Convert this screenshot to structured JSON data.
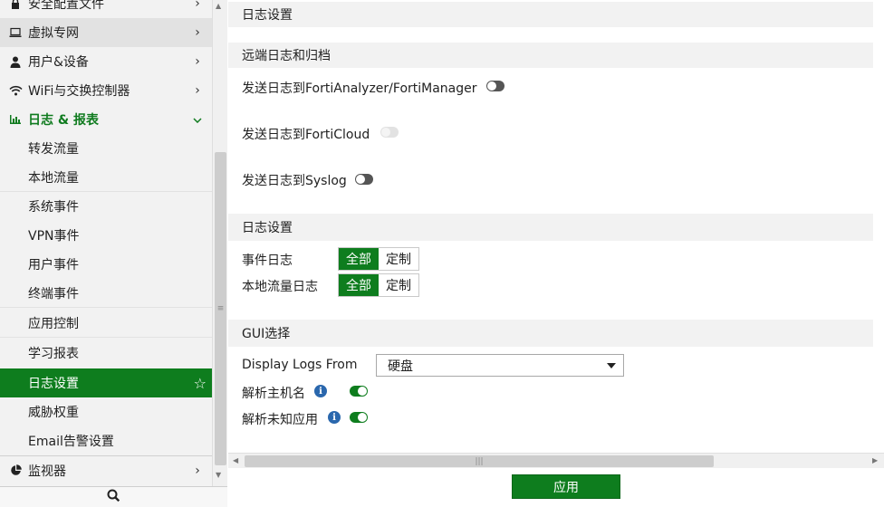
{
  "sidebar": {
    "items": [
      {
        "label": "安全配置文件",
        "icon": "lock-icon"
      },
      {
        "label": "虚拟专网",
        "icon": "laptop-icon"
      },
      {
        "label": "用户&设备",
        "icon": "user-icon"
      },
      {
        "label": "WiFi与交换控制器",
        "icon": "wifi-icon"
      },
      {
        "label": "日志 & 报表",
        "icon": "bar-chart-icon"
      }
    ],
    "subitems": [
      {
        "label": "转发流量"
      },
      {
        "label": "本地流量"
      },
      {
        "label": "系统事件"
      },
      {
        "label": "VPN事件"
      },
      {
        "label": "用户事件"
      },
      {
        "label": "终端事件"
      },
      {
        "label": "应用控制"
      },
      {
        "label": "学习报表"
      },
      {
        "label": "日志设置"
      },
      {
        "label": "威胁权重"
      },
      {
        "label": "Email告警设置"
      }
    ],
    "monitor": {
      "label": "监视器",
      "icon": "pie-chart-icon"
    },
    "search_icon": "search-icon",
    "accent": "#0e7d1e"
  },
  "main": {
    "page_title": "日志设置",
    "remote": {
      "title": "远端日志和归档",
      "faz_label": "发送日志到FortiAnalyzer/FortiManager",
      "cloud_label": "发送日志到FortiCloud",
      "syslog_label": "发送日志到Syslog"
    },
    "log_settings": {
      "title": "日志设置",
      "event_label": "事件日志",
      "local_label": "本地流量日志",
      "opt_all": "全部",
      "opt_custom": "定制"
    },
    "gui": {
      "title": "GUI选择",
      "display_label": "Display Logs From",
      "display_value": "硬盘",
      "resolve_host_label": "解析主机名",
      "resolve_app_label": "解析未知应用"
    },
    "apply_label": "应用"
  }
}
